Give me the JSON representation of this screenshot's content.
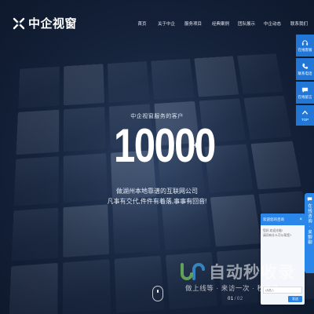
{
  "header": {
    "logo_text": "中企视窗",
    "nav": [
      "首页",
      "关于中企",
      "服务项目",
      "经典案例",
      "团队展示",
      "中企动态",
      "联系我们"
    ]
  },
  "hero": {
    "subtitle": "中企视窗服务的客户",
    "number": "10000",
    "plus": "+",
    "line1": "做湖州本地靠谱的互联网公司",
    "line2": "凡事有交代,件件有着落,事事有回音!"
  },
  "pager": {
    "current": "01",
    "separator": "/",
    "total": "02"
  },
  "float_bar": [
    {
      "label": "在线客服",
      "icon": "headset-icon"
    },
    {
      "label": "联系电话",
      "icon": "phone-icon"
    },
    {
      "label": "在线留言",
      "icon": "chat-icon"
    },
    {
      "label": "TOP",
      "icon": "arrow-up-icon"
    }
  ],
  "chat": {
    "tab_text": "在线咨询 · 来聊聊",
    "title": "欢迎您的咨询",
    "messages": [
      "您好,欢迎光临!",
      "请问有什么可以帮您?"
    ],
    "input_placeholder": "请输入",
    "send_label": "发送"
  },
  "watermark": {
    "text": "自动秒收录",
    "slogan": "做上线等 · 来访一次 · 秒收录"
  },
  "colors": {
    "accent": "#2277d6",
    "background": "#182b4a"
  }
}
